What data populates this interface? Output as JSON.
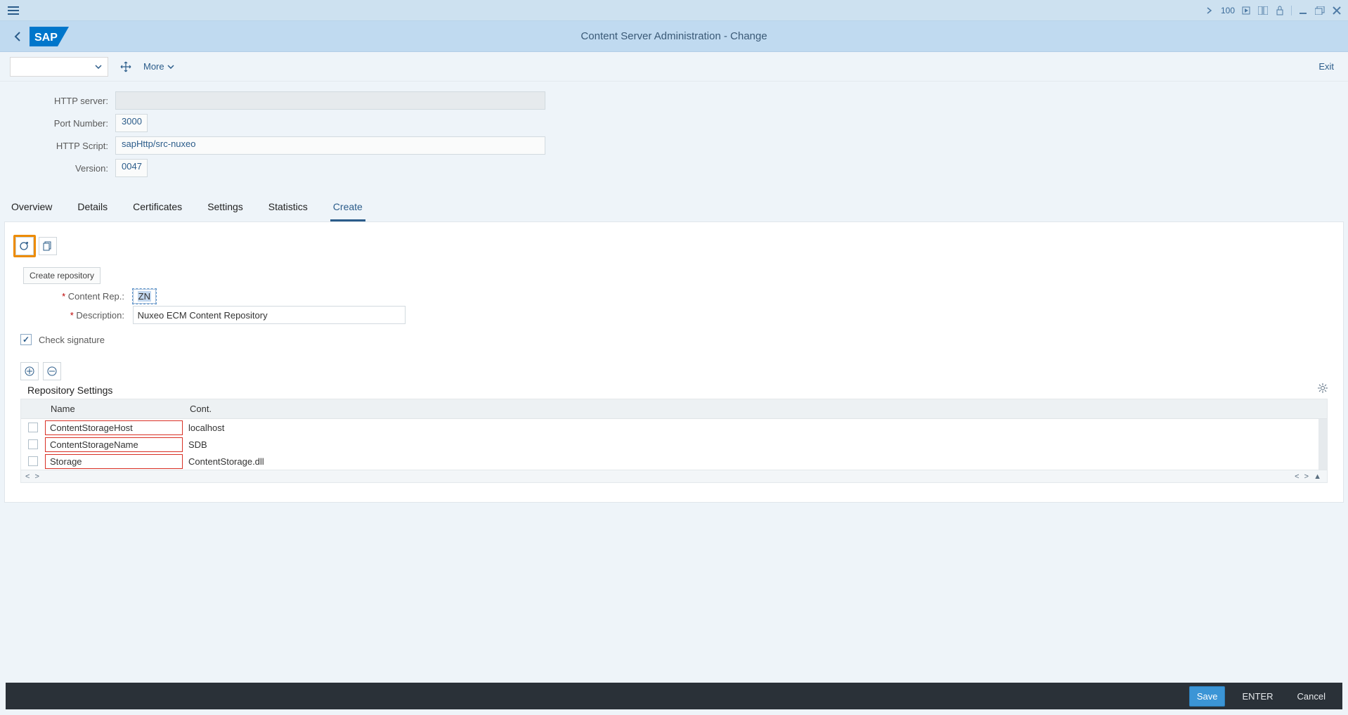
{
  "titlebar": {
    "zoom": "100"
  },
  "header": {
    "page_title": "Content Server Administration - Change"
  },
  "actionbar": {
    "more_label": "More",
    "exit_label": "Exit"
  },
  "form": {
    "http_server_label": "HTTP server:",
    "http_server_value": "",
    "port_label": "Port Number:",
    "port_value": "3000",
    "script_label": "HTTP Script:",
    "script_value": "sapHttp/src-nuxeo",
    "version_label": "Version:",
    "version_value": "0047"
  },
  "tabs": [
    {
      "label": "Overview"
    },
    {
      "label": "Details"
    },
    {
      "label": "Certificates"
    },
    {
      "label": "Settings"
    },
    {
      "label": "Statistics"
    },
    {
      "label": "Create"
    }
  ],
  "create": {
    "create_repo_btn": "Create repository",
    "content_rep_label": "Content Rep.:",
    "content_rep_value": "ZN",
    "description_label": "Description:",
    "description_value": "Nuxeo ECM Content Repository",
    "check_sig_label": "Check signature",
    "repo_settings_title": "Repository Settings",
    "table": {
      "headers": {
        "name": "Name",
        "cont": "Cont."
      },
      "rows": [
        {
          "name": "ContentStorageHost",
          "cont": "localhost"
        },
        {
          "name": "ContentStorageName",
          "cont": "SDB"
        },
        {
          "name": "Storage",
          "cont": "ContentStorage.dll"
        }
      ]
    }
  },
  "bottom": {
    "save": "Save",
    "enter": "ENTER",
    "cancel": "Cancel"
  }
}
